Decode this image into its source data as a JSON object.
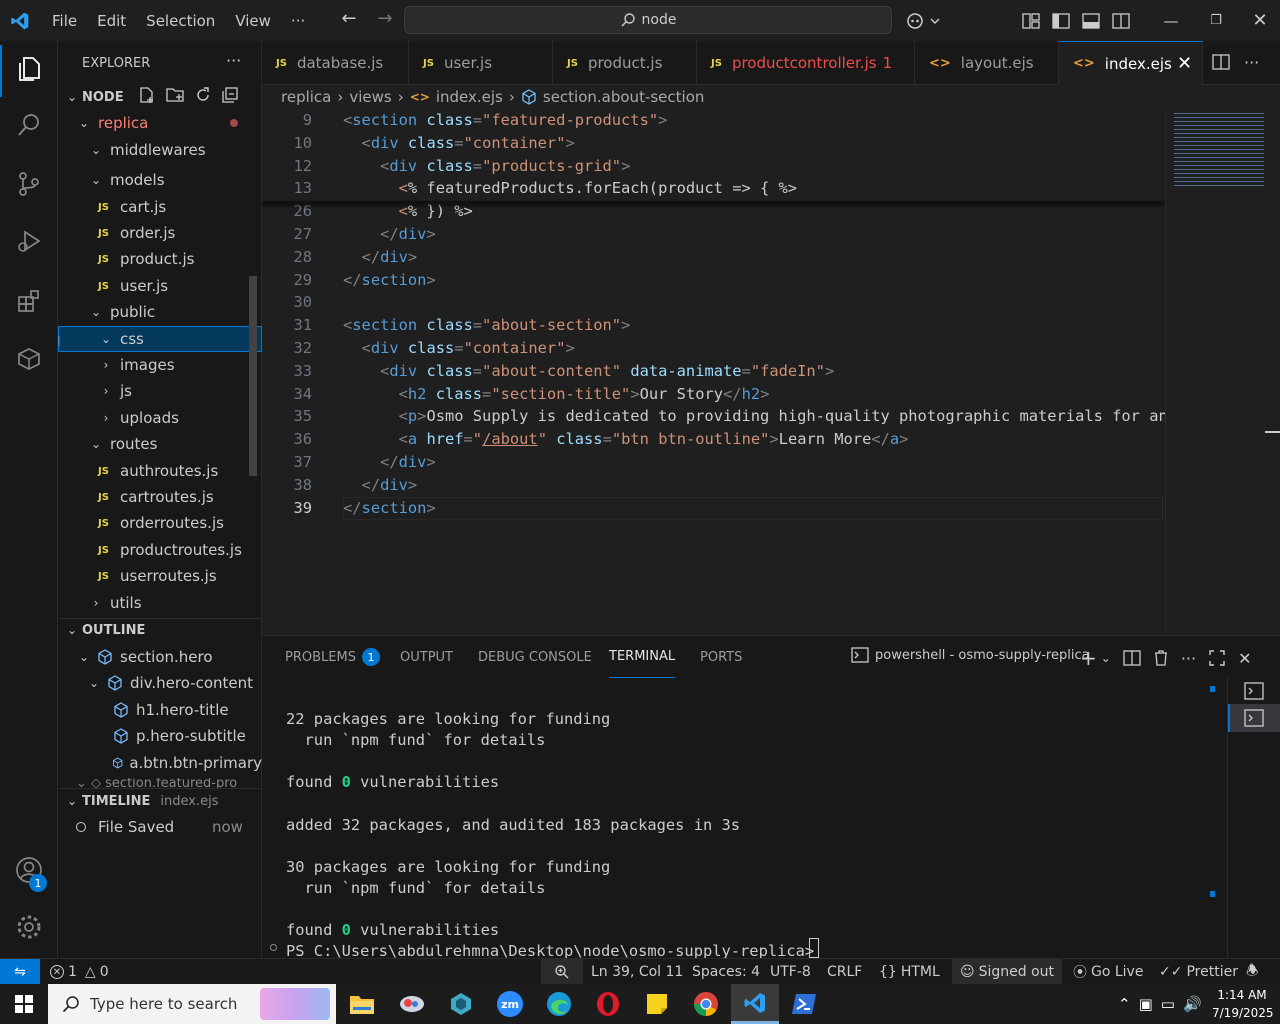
{
  "titlebar": {
    "menus": [
      "File",
      "Edit",
      "Selection",
      "View",
      "···"
    ],
    "search_text": "node"
  },
  "sidebar": {
    "title": "EXPLORER",
    "folder_root": "NODE",
    "tree": [
      {
        "label": "replica",
        "kind": "folder-open",
        "depth": 1
      },
      {
        "label": "middlewares",
        "kind": "folder-open",
        "depth": 2
      },
      {
        "label": "models",
        "kind": "folder-open",
        "depth": 2
      },
      {
        "label": "cart.js",
        "kind": "js",
        "depth": 3
      },
      {
        "label": "order.js",
        "kind": "js",
        "depth": 3
      },
      {
        "label": "product.js",
        "kind": "js",
        "depth": 3
      },
      {
        "label": "user.js",
        "kind": "js",
        "depth": 3
      },
      {
        "label": "public",
        "kind": "folder-open",
        "depth": 2
      },
      {
        "label": "css",
        "kind": "folder-open",
        "depth": 3
      },
      {
        "label": "images",
        "kind": "folder-closed",
        "depth": 3
      },
      {
        "label": "js",
        "kind": "folder-closed",
        "depth": 3
      },
      {
        "label": "uploads",
        "kind": "folder-closed",
        "depth": 3
      },
      {
        "label": "routes",
        "kind": "folder-open",
        "depth": 2
      },
      {
        "label": "authroutes.js",
        "kind": "js",
        "depth": 3
      },
      {
        "label": "cartroutes.js",
        "kind": "js",
        "depth": 3
      },
      {
        "label": "orderroutes.js",
        "kind": "js",
        "depth": 3
      },
      {
        "label": "productroutes.js",
        "kind": "js",
        "depth": 3
      },
      {
        "label": "userroutes.js",
        "kind": "js",
        "depth": 3
      },
      {
        "label": "utils",
        "kind": "folder-closed",
        "depth": 2
      }
    ],
    "outline_title": "OUTLINE",
    "outline": [
      {
        "label": "section.hero",
        "depth": 1,
        "chev": "v"
      },
      {
        "label": "div.hero-content",
        "depth": 2,
        "chev": "v"
      },
      {
        "label": "h1.hero-title",
        "depth": 3,
        "chev": ""
      },
      {
        "label": "p.hero-subtitle",
        "depth": 3,
        "chev": ""
      },
      {
        "label": "a.btn.btn-primary",
        "depth": 3,
        "chev": ""
      }
    ],
    "timeline_title": "TIMELINE",
    "timeline_file": "index.ejs",
    "timeline_item": "File Saved",
    "timeline_time": "now"
  },
  "tabs": [
    {
      "label": "database.js",
      "icon": "JS"
    },
    {
      "label": "user.js",
      "icon": "JS"
    },
    {
      "label": "product.js",
      "icon": "JS"
    },
    {
      "label": "productcontroller.js",
      "icon": "JS",
      "problems": "1"
    },
    {
      "label": "layout.ejs",
      "icon": "<>"
    },
    {
      "label": "index.ejs",
      "icon": "<>"
    }
  ],
  "breadcrumb": [
    "replica",
    "views",
    "index.ejs",
    "section.about-section"
  ],
  "editor": {
    "lines": [
      {
        "n": "9",
        "indent": "",
        "parts": [
          [
            "b",
            "<"
          ],
          [
            "t",
            "section"
          ],
          [
            "a",
            " class"
          ],
          [
            "b",
            "="
          ],
          [
            "s",
            "\"featured-products\""
          ],
          [
            "b",
            ">"
          ]
        ]
      },
      {
        "n": "10",
        "indent": "  ",
        "parts": [
          [
            "b",
            "<"
          ],
          [
            "t",
            "div"
          ],
          [
            "a",
            " class"
          ],
          [
            "b",
            "="
          ],
          [
            "s",
            "\"container\""
          ],
          [
            "b",
            ">"
          ]
        ]
      },
      {
        "n": "12",
        "indent": "    ",
        "parts": [
          [
            "b",
            "<"
          ],
          [
            "t",
            "div"
          ],
          [
            "a",
            " class"
          ],
          [
            "b",
            "="
          ],
          [
            "s",
            "\"products-grid\""
          ],
          [
            "b",
            ">"
          ]
        ]
      },
      {
        "n": "13",
        "indent": "      ",
        "parts": [
          [
            "e",
            "<"
          ],
          [
            "p",
            "% featuredProducts.forEach(product => { %>"
          ]
        ]
      },
      {
        "n": "26",
        "indent": "      ",
        "parts": [
          [
            "e",
            "<"
          ],
          [
            "p",
            "% }) %>"
          ]
        ]
      },
      {
        "n": "27",
        "indent": "    ",
        "parts": [
          [
            "b",
            "</"
          ],
          [
            "t",
            "div"
          ],
          [
            "b",
            ">"
          ]
        ]
      },
      {
        "n": "28",
        "indent": "  ",
        "parts": [
          [
            "b",
            "</"
          ],
          [
            "t",
            "div"
          ],
          [
            "b",
            ">"
          ]
        ]
      },
      {
        "n": "29",
        "indent": "",
        "parts": [
          [
            "b",
            "</"
          ],
          [
            "t",
            "section"
          ],
          [
            "b",
            ">"
          ]
        ]
      },
      {
        "n": "30",
        "indent": "",
        "parts": []
      },
      {
        "n": "31",
        "indent": "",
        "parts": [
          [
            "b",
            "<"
          ],
          [
            "t",
            "section"
          ],
          [
            "a",
            " class"
          ],
          [
            "b",
            "="
          ],
          [
            "s",
            "\"about-section\""
          ],
          [
            "b",
            ">"
          ]
        ]
      },
      {
        "n": "32",
        "indent": "  ",
        "parts": [
          [
            "b",
            "<"
          ],
          [
            "t",
            "div"
          ],
          [
            "a",
            " class"
          ],
          [
            "b",
            "="
          ],
          [
            "s",
            "\"container\""
          ],
          [
            "b",
            ">"
          ]
        ]
      },
      {
        "n": "33",
        "indent": "    ",
        "parts": [
          [
            "b",
            "<"
          ],
          [
            "t",
            "div"
          ],
          [
            "a",
            " class"
          ],
          [
            "b",
            "="
          ],
          [
            "s",
            "\"about-content\""
          ],
          [
            "a",
            " data-animate"
          ],
          [
            "b",
            "="
          ],
          [
            "s",
            "\"fadeIn\""
          ],
          [
            "b",
            ">"
          ]
        ]
      },
      {
        "n": "34",
        "indent": "      ",
        "parts": [
          [
            "b",
            "<"
          ],
          [
            "t",
            "h2"
          ],
          [
            "a",
            " class"
          ],
          [
            "b",
            "="
          ],
          [
            "s",
            "\"section-title\""
          ],
          [
            "b",
            ">"
          ],
          [
            "p",
            "Our Story"
          ],
          [
            "b",
            "</"
          ],
          [
            "t",
            "h2"
          ],
          [
            "b",
            ">"
          ]
        ]
      },
      {
        "n": "35",
        "indent": "      ",
        "parts": [
          [
            "b",
            "<"
          ],
          [
            "t",
            "p"
          ],
          [
            "b",
            ">"
          ],
          [
            "p",
            "Osmo Supply is dedicated to providing high-quality photographic materials for an"
          ]
        ]
      },
      {
        "n": "36",
        "indent": "      ",
        "parts": [
          [
            "b",
            "<"
          ],
          [
            "t",
            "a"
          ],
          [
            "a",
            " href"
          ],
          [
            "b",
            "="
          ],
          [
            "s",
            "\""
          ],
          [
            "u",
            "/about"
          ],
          [
            "s",
            "\""
          ],
          [
            "a",
            " class"
          ],
          [
            "b",
            "="
          ],
          [
            "s",
            "\"btn btn-outline\""
          ],
          [
            "b",
            ">"
          ],
          [
            "p",
            "Learn More"
          ],
          [
            "b",
            "</"
          ],
          [
            "t",
            "a"
          ],
          [
            "b",
            ">"
          ]
        ]
      },
      {
        "n": "37",
        "indent": "    ",
        "parts": [
          [
            "b",
            "</"
          ],
          [
            "t",
            "div"
          ],
          [
            "b",
            ">"
          ]
        ]
      },
      {
        "n": "38",
        "indent": "  ",
        "parts": [
          [
            "b",
            "</"
          ],
          [
            "t",
            "div"
          ],
          [
            "b",
            ">"
          ]
        ]
      },
      {
        "n": "39",
        "indent": "",
        "parts": [
          [
            "b",
            "</"
          ],
          [
            "t",
            "section"
          ],
          [
            "b",
            ">"
          ]
        ]
      }
    ]
  },
  "panel": {
    "tabs": [
      "PROBLEMS",
      "OUTPUT",
      "DEBUG CONSOLE",
      "TERMINAL",
      "PORTS"
    ],
    "problems_count": "1",
    "terminal_name": "powershell - osmo-supply-replica",
    "terminal_lines": [
      "",
      "22 packages are looking for funding",
      "  run `npm fund` for details",
      "",
      "found 0 vulnerabilities",
      "",
      "added 32 packages, and audited 183 packages in 3s",
      "",
      "30 packages are looking for funding",
      "  run `npm fund` for details",
      "",
      "found 0 vulnerabilities",
      "PS C:\\Users\\abdulrehmna\\Desktop\\node\\osmo-supply-replica> "
    ]
  },
  "statusbar": {
    "errors": "1",
    "warnings": "0",
    "position": "Ln 39, Col 11",
    "spaces": "Spaces: 4",
    "encoding": "UTF-8",
    "eol": "CRLF",
    "language": "HTML",
    "account": "Signed out",
    "golive": "Go Live",
    "prettier": "Prettier"
  },
  "taskbar": {
    "search_placeholder": "Type here to search",
    "time": "1:14 AM",
    "date": "7/19/2025"
  },
  "colors": {
    "accent": "#0078d4",
    "error_tab": "#f14c4c",
    "js_icon": "#e8d44d"
  }
}
